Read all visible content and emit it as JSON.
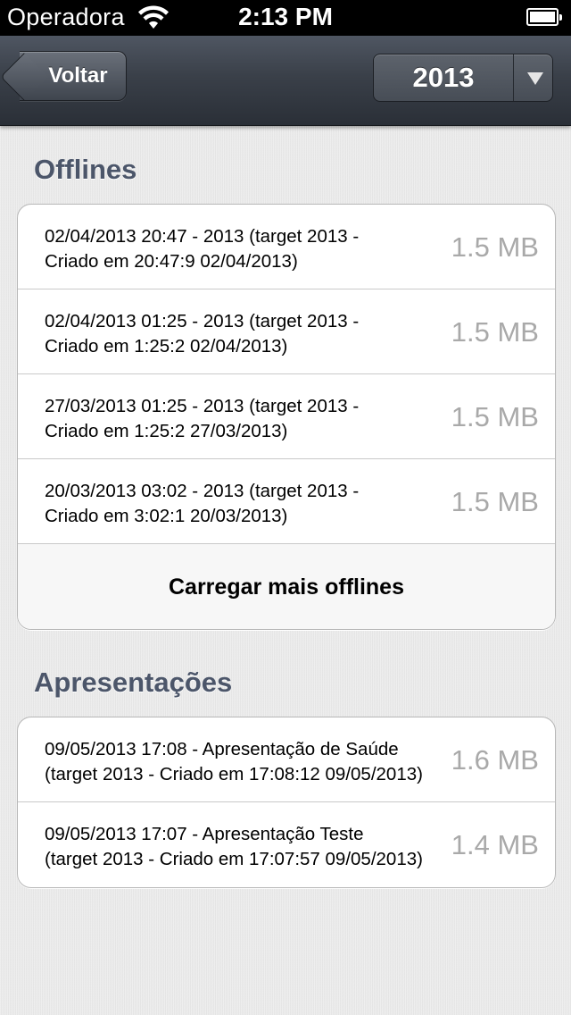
{
  "status_bar": {
    "carrier": "Operadora",
    "time": "2:13 PM",
    "icons": [
      "wifi-icon",
      "battery-icon"
    ]
  },
  "nav": {
    "back_label": "Voltar",
    "year": "2013",
    "dropdown_icon": "chevron-down-icon"
  },
  "offlines": {
    "title": "Offlines",
    "items": [
      {
        "line1": "02/04/2013 20:47 - 2013 (target 2013 -",
        "line2": "Criado em 20:47:9 02/04/2013)",
        "size": "1.5 MB"
      },
      {
        "line1": "02/04/2013 01:25 - 2013 (target 2013 -",
        "line2": "Criado em 1:25:2 02/04/2013)",
        "size": "1.5 MB"
      },
      {
        "line1": "27/03/2013 01:25 - 2013 (target 2013 -",
        "line2": "Criado em 1:25:2 27/03/2013)",
        "size": "1.5 MB"
      },
      {
        "line1": "20/03/2013 03:02 - 2013 (target 2013 -",
        "line2": "Criado em 3:02:1 20/03/2013)",
        "size": "1.5 MB"
      }
    ],
    "load_more_label": "Carregar mais offlines"
  },
  "presentations": {
    "title": "Apresentações",
    "items": [
      {
        "line1": "09/05/2013 17:08 - Apresentação de Saúde",
        "line2": "(target 2013 - Criado em 17:08:12 09/05/2013)",
        "size": "1.6 MB"
      },
      {
        "line1": "09/05/2013 17:07 - Apresentação Teste",
        "line2": "(target 2013 - Criado em 17:07:57 09/05/2013)",
        "size": "1.4 MB"
      }
    ]
  }
}
